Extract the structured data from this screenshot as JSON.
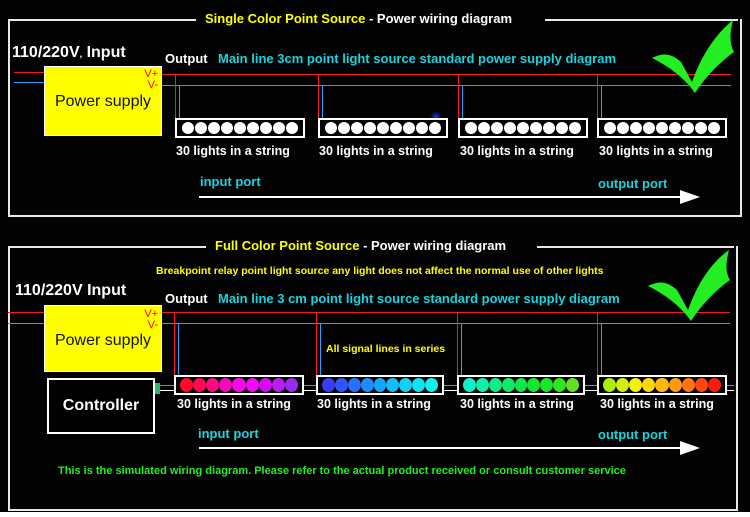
{
  "colors": {
    "background": "#030303",
    "frame": "#e8e8e8",
    "title_highlight": "#ffff00",
    "subtitle_cyan": "#19d3df",
    "positive_wire": "#ff1a1a",
    "negative_wire": "#2b9fff",
    "signal_wire": "#2db56a",
    "power_supply_fill": "#ffff00",
    "check_mark": "#22ee22",
    "note_green": "#22ee22"
  },
  "single_color": {
    "title_highlight": "Single Color Point Source",
    "title_rest": " - Power wiring diagram",
    "input_label": "110/220V",
    "input_label_sep": ",",
    "input_label_suffix": " Input",
    "power_supply": {
      "label": "Power supply",
      "v_plus": "V+",
      "v_minus": "V-"
    },
    "output_label": "Output",
    "main_line_label": "Main line 3cm point light source standard power supply diagram",
    "check_icon": "check-mark-icon",
    "strings": [
      {
        "label": "30 lights in a string",
        "dots": [
          "#ffffff",
          "#ffffff",
          "#ffffff",
          "#ffffff",
          "#ffffff",
          "#ffffff",
          "#ffffff",
          "#ffffff",
          "#ffffff"
        ]
      },
      {
        "label": "30 lights in a string",
        "dots": [
          "#ffffff",
          "#ffffff",
          "#ffffff",
          "#ffffff",
          "#ffffff",
          "#ffffff",
          "#ffffff",
          "#ffffff",
          "#ffffff"
        ]
      },
      {
        "label": "30 lights in a string",
        "dots": [
          "#ffffff",
          "#ffffff",
          "#ffffff",
          "#ffffff",
          "#ffffff",
          "#ffffff",
          "#ffffff",
          "#ffffff",
          "#ffffff"
        ]
      },
      {
        "label": "30 lights in a string",
        "dots": [
          "#ffffff",
          "#ffffff",
          "#ffffff",
          "#ffffff",
          "#ffffff",
          "#ffffff",
          "#ffffff",
          "#ffffff",
          "#ffffff"
        ]
      }
    ],
    "input_port": "input port",
    "output_port": "output port"
  },
  "full_color": {
    "title_highlight": "Full Color Point Source",
    "title_rest": " - Power wiring diagram",
    "breakpoint_note": "Breakpoint relay point light source any light does not affect the normal use of other lights",
    "input_label": "110/220V Input",
    "power_supply": {
      "label": "Power supply",
      "v_plus": "V+",
      "v_minus": "V-"
    },
    "controller_label": "Controller",
    "output_label": "Output",
    "main_line_label": "Main line 3 cm point light source standard power supply diagram",
    "signal_note": "All signal lines in series",
    "check_icon": "check-mark-icon",
    "strings": [
      {
        "label": "30 lights in a string",
        "dots": [
          "#ff0a2a",
          "#ff0a55",
          "#ff0a80",
          "#f50ab8",
          "#f50ae6",
          "#f00af5",
          "#d80af5",
          "#b81ef0",
          "#9a2aef"
        ]
      },
      {
        "label": "30 lights in a string",
        "dots": [
          "#3a3cff",
          "#2f55ff",
          "#2570ff",
          "#1c8cff",
          "#18a6fb",
          "#14bcf8",
          "#14d0f5",
          "#10e2f4",
          "#10f0ee"
        ]
      },
      {
        "label": "30 lights in a string",
        "dots": [
          "#10f0c8",
          "#10eeaa",
          "#10ec88",
          "#10ea66",
          "#10e84a",
          "#14e634",
          "#18e626",
          "#2ce620",
          "#60e024"
        ]
      },
      {
        "label": "30 lights in a string",
        "dots": [
          "#a8ee10",
          "#d0ee10",
          "#f6f010",
          "#ffd810",
          "#ffba10",
          "#ff9a10",
          "#ff7410",
          "#ff4810",
          "#ff1a10"
        ]
      }
    ],
    "input_port": "input port",
    "output_port": "output port",
    "footer_note": "This is the simulated wiring diagram. Please refer to the actual product received or consult customer service"
  }
}
